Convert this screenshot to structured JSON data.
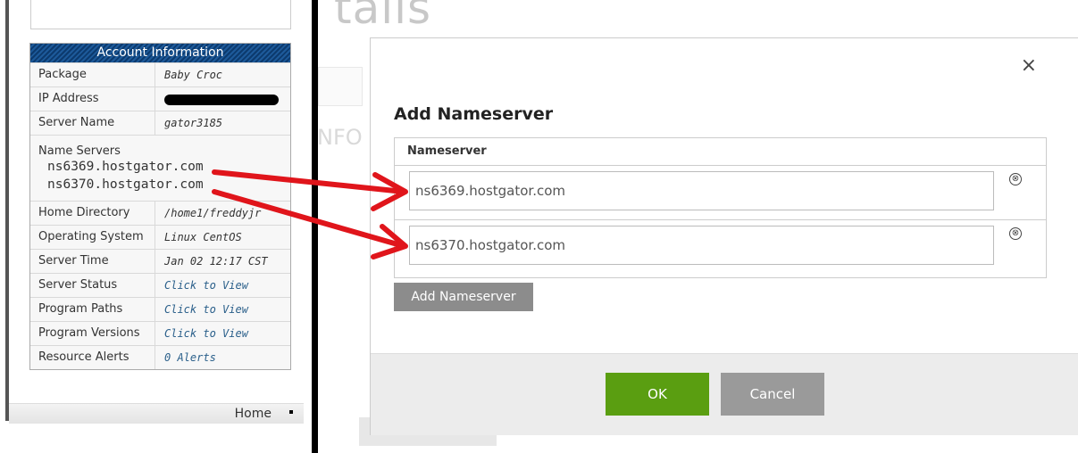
{
  "account": {
    "title": "Account Information",
    "rows_top": [
      {
        "label": "Package",
        "value": "Baby Croc"
      },
      {
        "label": "IP Address",
        "value": ""
      },
      {
        "label": "Server Name",
        "value": "gator3185"
      }
    ],
    "name_servers_label": "Name Servers",
    "name_servers": [
      "ns6369.hostgator.com",
      "ns6370.hostgator.com"
    ],
    "rows_bottom": [
      {
        "label": "Home Directory",
        "value": "/home1/freddyjr"
      },
      {
        "label": "Operating System",
        "value": "Linux CentOS"
      },
      {
        "label": "Server Time",
        "value": "Jan 02 12:17 CST"
      },
      {
        "label": "Server Status",
        "value": "Click to View"
      },
      {
        "label": "Program Paths",
        "value": "Click to View"
      },
      {
        "label": "Program Versions",
        "value": "Click to View"
      },
      {
        "label": "Resource Alerts",
        "value": "0 Alerts"
      }
    ]
  },
  "footer_nav": {
    "home": "Home"
  },
  "background": {
    "title": "tails",
    "nfo": "NFO"
  },
  "modal": {
    "close_glyph": "×",
    "title": "Add Nameserver",
    "column_header": "Nameserver",
    "nameservers": [
      "ns6369.hostgator.com",
      "ns6370.hostgator.com"
    ],
    "remove_glyph": "⊗",
    "add_button": "Add Nameserver",
    "ok_button": "OK",
    "cancel_button": "Cancel"
  },
  "colors": {
    "ok": "#5a9e11",
    "arrow": "#e0151b",
    "header": "#0c3a6e"
  }
}
